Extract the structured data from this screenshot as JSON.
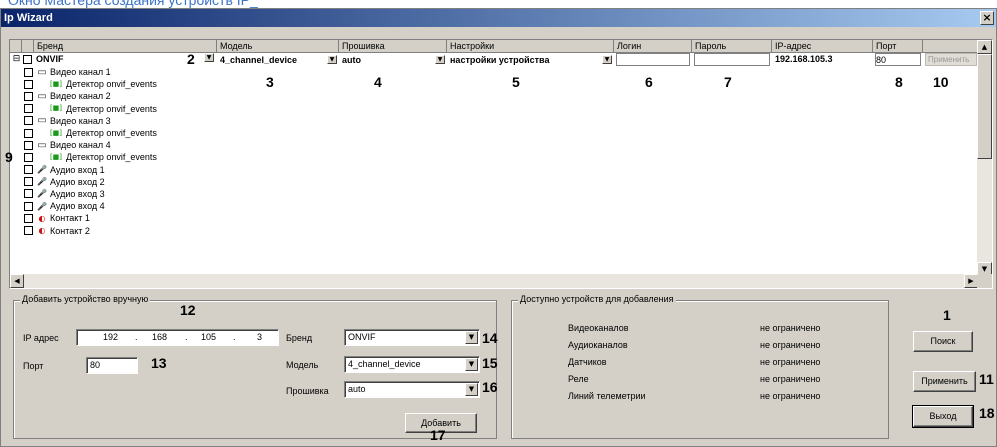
{
  "page": {
    "doc_header": "Окно Мастера создания устройств IP_"
  },
  "window": {
    "title": "Ip Wizard",
    "close_glyph": "×"
  },
  "grid": {
    "columns": [
      "Бренд",
      "Модель",
      "Прошивка",
      "Настройки",
      "Логин",
      "Пароль",
      "IP-адрес",
      "Порт"
    ],
    "main_row": {
      "brand": "ONVIF",
      "model": "4_channel_device",
      "firmware": "auto",
      "settings": "настройки устройства",
      "login": "",
      "password": "",
      "ip": "192.168.105.3",
      "port": "80",
      "apply": "Применить"
    },
    "items": [
      {
        "label": "Видео канал 1",
        "icon": "camera-icon",
        "indent": false
      },
      {
        "label": "Детектор onvif_events",
        "icon": "detector-icon",
        "indent": true
      },
      {
        "label": "Видео канал 2",
        "icon": "camera-icon",
        "indent": false
      },
      {
        "label": "Детектор onvif_events",
        "icon": "detector-icon",
        "indent": true
      },
      {
        "label": "Видео канал 3",
        "icon": "camera-icon",
        "indent": false
      },
      {
        "label": "Детектор onvif_events",
        "icon": "detector-icon",
        "indent": true
      },
      {
        "label": "Видео канал 4",
        "icon": "camera-icon",
        "indent": false
      },
      {
        "label": "Детектор onvif_events",
        "icon": "detector-icon",
        "indent": true
      },
      {
        "label": "Аудио вход 1",
        "icon": "microphone-icon",
        "indent": false
      },
      {
        "label": "Аудио вход 2",
        "icon": "microphone-icon",
        "indent": false
      },
      {
        "label": "Аудио вход 3",
        "icon": "microphone-icon",
        "indent": false
      },
      {
        "label": "Аудио вход 4",
        "icon": "microphone-icon",
        "indent": false
      },
      {
        "label": "Контакт 1",
        "icon": "contact-icon",
        "indent": false
      },
      {
        "label": "Контакт 2",
        "icon": "contact-icon",
        "indent": false
      }
    ]
  },
  "manual": {
    "legend": "Добавить устройство вручную",
    "ip_label": "IP адрес",
    "ip_octets": [
      "192",
      "168",
      "105",
      "3"
    ],
    "ip_dot": ".",
    "port_label": "Порт",
    "port_value": "80",
    "brand_label": "Бренд",
    "brand_value": "ONVIF",
    "model_label": "Модель",
    "model_value": "4_channel_device",
    "firmware_label": "Прошивка",
    "firmware_value": "auto",
    "add_button": "Добавить"
  },
  "available": {
    "legend": "Доступно устройств для добавления",
    "rows": [
      {
        "label": "Видеоканалов",
        "value": "не ограничено"
      },
      {
        "label": "Аудиоканалов",
        "value": "не ограничено"
      },
      {
        "label": "Датчиков",
        "value": "не ограничено"
      },
      {
        "label": "Реле",
        "value": "не ограничено"
      },
      {
        "label": "Линий телеметрии",
        "value": "не ограничено"
      }
    ]
  },
  "buttons": {
    "search": "Поиск",
    "apply": "Применить",
    "exit": "Выход"
  },
  "callouts": {
    "n1": "1",
    "n2": "2",
    "n3": "3",
    "n4": "4",
    "n5": "5",
    "n6": "6",
    "n7": "7",
    "n8": "8",
    "n9": "9",
    "n10": "10",
    "n11": "11",
    "n12": "12",
    "n13": "13",
    "n14": "14",
    "n15": "15",
    "n16": "16",
    "n17": "17",
    "n18": "18"
  },
  "glyphs": {
    "dropdown": "▼",
    "up": "▲",
    "down": "▼",
    "left": "◀",
    "right": "▶",
    "collapse": "⊟",
    "camera": "▭",
    "detector": "[■]",
    "microphone": "🎤",
    "contact": "◐"
  }
}
